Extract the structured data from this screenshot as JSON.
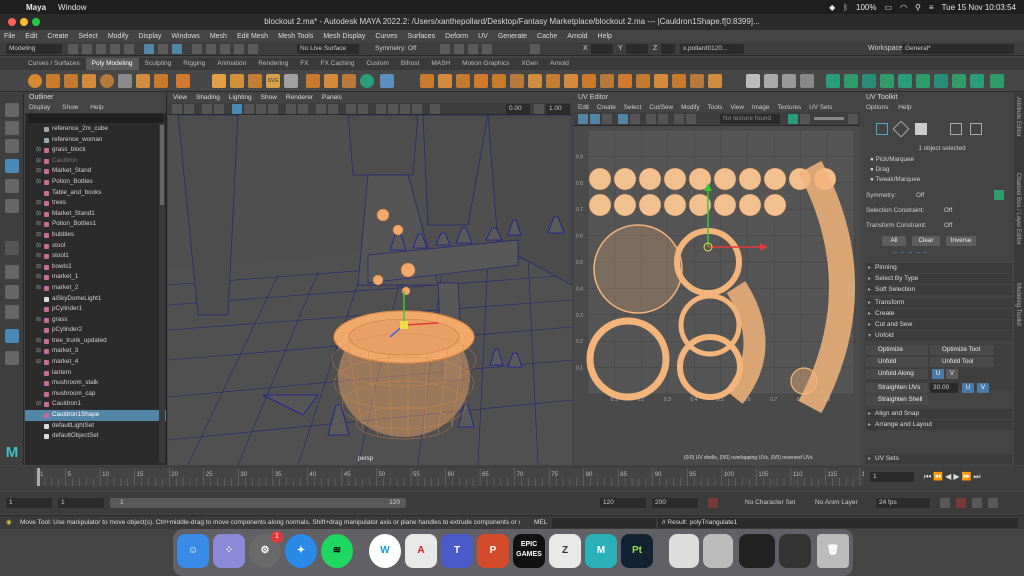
{
  "mac": {
    "app": "Maya",
    "menu": [
      "Window"
    ],
    "battery": "100%",
    "datetime": "Tue 15 Nov  10:03:54"
  },
  "window": {
    "title": "blockout 2.ma* - Autodesk MAYA 2022.2: /Users/xanthepollard/Desktop/Fantasy Marketplace/blockout 2.ma  ---  |Cauldron1Shape.f[0:8399]..."
  },
  "maya_menu": [
    "File",
    "Edit",
    "Create",
    "Select",
    "Modify",
    "Display",
    "Windows",
    "Mesh",
    "Edit Mesh",
    "Mesh Tools",
    "Mesh Display",
    "Curves",
    "Surfaces",
    "Deform",
    "UV",
    "Generate",
    "Cache",
    "Arnold",
    "Help"
  ],
  "status": {
    "mode": "Modeling",
    "live_surface": "No Live Surface",
    "symmetry": "Symmetry: Off",
    "x": "X",
    "y": "Y",
    "z": "Z",
    "user": "x.pollard0120...",
    "workspace_label": "Workspace:",
    "workspace_value": "General*"
  },
  "shelf_tabs": [
    "Curves / Surfaces",
    "Poly Modeling",
    "Sculpting",
    "Rigging",
    "Animation",
    "Rendering",
    "FX",
    "FX Caching",
    "Custom",
    "Bifrost",
    "MASH",
    "Motion Graphics",
    "XGen",
    "Arnold"
  ],
  "shelf_active": "Poly Modeling",
  "outliner": {
    "title": "Outliner",
    "menu": [
      "Display",
      "Show",
      "Help"
    ],
    "items": [
      {
        "label": "reference_2m_cube",
        "expand": false,
        "state": ""
      },
      {
        "label": "reference_woman",
        "expand": false,
        "state": ""
      },
      {
        "label": "grass_block",
        "expand": true,
        "state": ""
      },
      {
        "label": "Cauldron",
        "expand": true,
        "state": "dim"
      },
      {
        "label": "Market_Stand",
        "expand": true,
        "state": ""
      },
      {
        "label": "Potion_Bottles",
        "expand": true,
        "state": ""
      },
      {
        "label": "Table_and_books",
        "expand": false,
        "state": ""
      },
      {
        "label": "trees",
        "expand": true,
        "state": ""
      },
      {
        "label": "Market_Stand1",
        "expand": true,
        "state": ""
      },
      {
        "label": "Potion_Bottles1",
        "expand": true,
        "state": ""
      },
      {
        "label": "bubbles",
        "expand": true,
        "state": ""
      },
      {
        "label": "stool",
        "expand": true,
        "state": ""
      },
      {
        "label": "stool1",
        "expand": true,
        "state": ""
      },
      {
        "label": "bowls1",
        "expand": true,
        "state": ""
      },
      {
        "label": "market_1",
        "expand": true,
        "state": ""
      },
      {
        "label": "market_2",
        "expand": true,
        "state": ""
      },
      {
        "label": "aiSkyDomeLight1",
        "expand": false,
        "state": ""
      },
      {
        "label": "pCylinder1",
        "expand": false,
        "state": ""
      },
      {
        "label": "grass",
        "expand": true,
        "state": ""
      },
      {
        "label": "pCylinder2",
        "expand": false,
        "state": ""
      },
      {
        "label": "tree_trunk_updated",
        "expand": true,
        "state": ""
      },
      {
        "label": "market_3",
        "expand": true,
        "state": ""
      },
      {
        "label": "market_4",
        "expand": true,
        "state": ""
      },
      {
        "label": "lantern",
        "expand": false,
        "state": ""
      },
      {
        "label": "mushroom_stalk",
        "expand": false,
        "state": ""
      },
      {
        "label": "mushroom_cap",
        "expand": false,
        "state": ""
      },
      {
        "label": "Cauldron1",
        "expand": true,
        "state": ""
      },
      {
        "label": "Cauldron1Shape",
        "expand": false,
        "state": "sel"
      },
      {
        "label": "defaultLightSet",
        "expand": false,
        "state": ""
      },
      {
        "label": "defaultObjectSet",
        "expand": false,
        "state": ""
      }
    ]
  },
  "viewport": {
    "menu": [
      "View",
      "Shading",
      "Lighting",
      "Show",
      "Renderer",
      "Panels"
    ],
    "camera": "persp",
    "field1": "0.00",
    "field2": "1.00"
  },
  "uv_editor": {
    "title": "UV Editor",
    "menu": [
      "Edit",
      "Create",
      "Select",
      "Cut/Sew",
      "Modify",
      "Tools",
      "View",
      "Image",
      "Textures",
      "UV Sets"
    ],
    "texture_placeholder": "No texture found",
    "status": "(0/0) UV shells, (0/0) overlapping UVs, (0/0) reversed UVs",
    "grid_labels": [
      "0.1",
      "0.2",
      "0.3",
      "0.4",
      "0.5",
      "0.6",
      "0.7",
      "0.8",
      "0.9"
    ]
  },
  "uv_toolkit": {
    "title": "UV Toolkit",
    "menu": [
      "Options",
      "Help"
    ],
    "selected": "1 object selected",
    "modes": [
      "Pick/Marquee",
      "Drag",
      "Tweak/Marquee"
    ],
    "symmetry_label": "Symmetry:",
    "symmetry_value": "Off",
    "sel_constraint_label": "Selection Constraint:",
    "sel_constraint_value": "Off",
    "xform_constraint_label": "Transform Constraint:",
    "xform_constraint_value": "Off",
    "btn_all": "All",
    "btn_clear": "Clear",
    "btn_inverse": "Inverse",
    "sections1": [
      "Pinning",
      "Select By Type",
      "Soft Selection"
    ],
    "sections2": [
      "Transform",
      "Create",
      "Cut and Sew",
      "Unfold"
    ],
    "unfold": {
      "optimize": "Optimize",
      "optimize_tool": "Optimize Tool",
      "unfold": "Unfold",
      "unfold_tool": "Unfold Tool",
      "unfold_along": "Unfold Along",
      "u": "U",
      "v": "V",
      "straighten_uvs": "Straighten UVs",
      "straighten_value": "30.00",
      "straighten_shell": "Straighten Shell"
    },
    "sections3": [
      "Align and Snap",
      "Arrange and Layout"
    ],
    "uv_sets": "UV Sets",
    "side_tabs": [
      "Attribute Editor",
      "Channel Box / Layer Editor",
      "Modeling Toolkit"
    ]
  },
  "time": {
    "ticks": [
      "1",
      "5",
      "10",
      "15",
      "20",
      "25",
      "30",
      "35",
      "40",
      "45",
      "50",
      "55",
      "60",
      "65",
      "70",
      "75",
      "80",
      "85",
      "90",
      "95",
      "100",
      "105",
      "110",
      "115",
      "120"
    ],
    "current_frame": "1",
    "range_start": "1",
    "range_start2": "1",
    "range_inner_start": "1",
    "range_inner_end": "120",
    "range_end": "120",
    "range_end2": "200",
    "char_set": "No Character Set",
    "anim_layer": "No Anim Layer",
    "fps": "24 fps"
  },
  "help_line": "Move Tool: Use manipulator to move object(s). Ctrl+middle-drag to move components along normals. Shift+drag manipulator axis or plane handles to extrude components or clone objects. Ct",
  "cmd": {
    "lang": "MEL",
    "result": "// Result: polyTriangulate1"
  },
  "dock": {
    "badge": "1",
    "epic": "EPIC GAMES",
    "maya": "M",
    "pt": "Pt"
  },
  "colors": {
    "wire": "#1a1aa0",
    "selected": "#f2a86b",
    "selection_bg": "#5285a6"
  }
}
